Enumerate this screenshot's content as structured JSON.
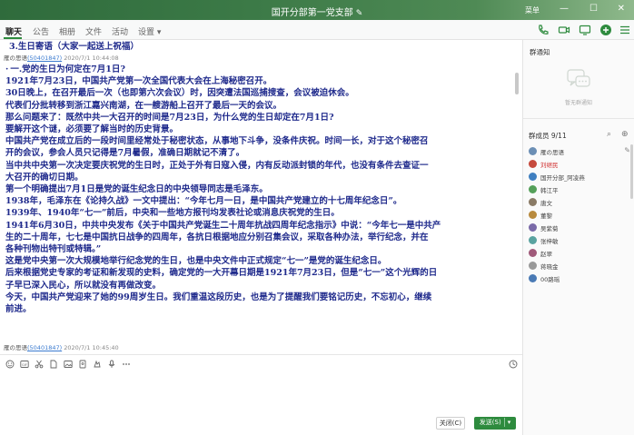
{
  "window": {
    "title": "国开分部第一党支部",
    "menu_label": "菜单",
    "min_glyph": "—",
    "max_glyph": "☐",
    "close_glyph": "✕"
  },
  "tabs": [
    {
      "label": "聊天",
      "active": true
    },
    {
      "label": "公告"
    },
    {
      "label": "相册"
    },
    {
      "label": "文件"
    },
    {
      "label": "活动"
    },
    {
      "label": "设置 ▾"
    }
  ],
  "chat": {
    "partial_header": "3.生日寄语（大家一起送上祝福）",
    "messages": [
      {
        "sender": "雁の思语",
        "sender_id": "(50401847)",
        "time": "2020/7/1 10:44:08",
        "lines": [
          "一.党的生日为何定在7月1日?",
          "1921年7月23日，中国共产党第一次全国代表大会在上海秘密召开。",
          "30日晚上，在召开最后一次（也即第六次会议）时，因突遭法国巡捕搜查，会议被迫休会。",
          "代表们分批转移到浙江嘉兴南湖，在一艘游船上召开了最后一天的会议。",
          "那么问题来了：既然中共一大召开的时间是7月23日，为什么党的生日却定在7月1日?",
          "要解开这个谜，必须要了解当时的历史背景。",
          "中国共产党在成立后的一段时间里经常处于秘密状态，从事地下斗争，没条件庆祝。时间一长，对于这个秘密召",
          "开的会议，参会人员只记得是7月暑假，准确日期就记不清了。",
          "当中共中央第一次决定要庆祝党的生日时，正处于外有日寇入侵，内有反动派封锁的年代，也没有条件去查证一",
          "大召开的确切日期。",
          "第一个明确提出7月1日是党的诞生纪念日的中央领导同志是毛泽东。",
          "1938年，毛泽东在《论持久战》一文中提出：“今年七月一日，是中国共产党建立的十七周年纪念日”。",
          "1939年、1940年“七一”前后，中央和一些地方报刊均发表社论或消息庆祝党的生日。",
          "1941年6月30日，中共中央发布《关于中国共产党诞生二十周年抗战四周年纪念指示》中说：“今年七一是中共产",
          "生的二十周年，七七是中国抗日战争的四周年，各抗日根据地应分别召集会议，采取各种办法，举行纪念，并在",
          "各种刊物出特刊或特辑。”",
          "这是党中央第一次大规模地举行纪念党的生日，也是中央文件中正式规定“七一”是党的诞生纪念日。",
          "后来根据党史专家的考证和新发现的史料，确定党的一大开幕日期是1921年7月23日，但是“七一”这个光辉的日",
          "子早已深入民心，所以就没有再做改变。",
          "今天，中国共产党迎来了她的99周岁生日。我们重温这段历史，也是为了提醒我们要铭记历史，不忘初心，继续",
          "前进。"
        ]
      },
      {
        "sender": "雁の思语",
        "sender_id": "(50401847)",
        "time": "2020/7/1 10:45:40"
      }
    ]
  },
  "bottom": {
    "close_label": "关闭(C)",
    "send_label": "发送(S)",
    "send_arrow": "▾"
  },
  "right_panel": {
    "notice_title": "群通知",
    "notice_empty": "暂无群通知",
    "members_title": "群成员 9/11",
    "members": [
      {
        "name": "雁の思语",
        "color": "#6c8fb5",
        "highlight": false,
        "action": "✎"
      },
      {
        "name": "刘继民",
        "color": "#c64a3d",
        "highlight": true
      },
      {
        "name": "国开分部_阿凌燕",
        "color": "#3f7fc0",
        "highlight": false
      },
      {
        "name": "韩江平",
        "color": "#55a05a",
        "highlight": false
      },
      {
        "name": "唐文",
        "color": "#8a7b66",
        "highlight": false
      },
      {
        "name": "董黎",
        "color": "#b88a3d",
        "highlight": false
      },
      {
        "name": "吴紫菊",
        "color": "#7a6aa8",
        "highlight": false
      },
      {
        "name": "张梓敏",
        "color": "#5aa3a0",
        "highlight": false
      },
      {
        "name": "赵翠",
        "color": "#a05a7a",
        "highlight": false
      },
      {
        "name": "蒋晓金",
        "color": "#999999",
        "highlight": false
      },
      {
        "name": "00路瑶",
        "color": "#4a7ab5",
        "highlight": false
      }
    ]
  },
  "colors": {
    "accent": "#2e8b3e",
    "message_text": "#1f2a8c",
    "link": "#3b7bd0"
  }
}
